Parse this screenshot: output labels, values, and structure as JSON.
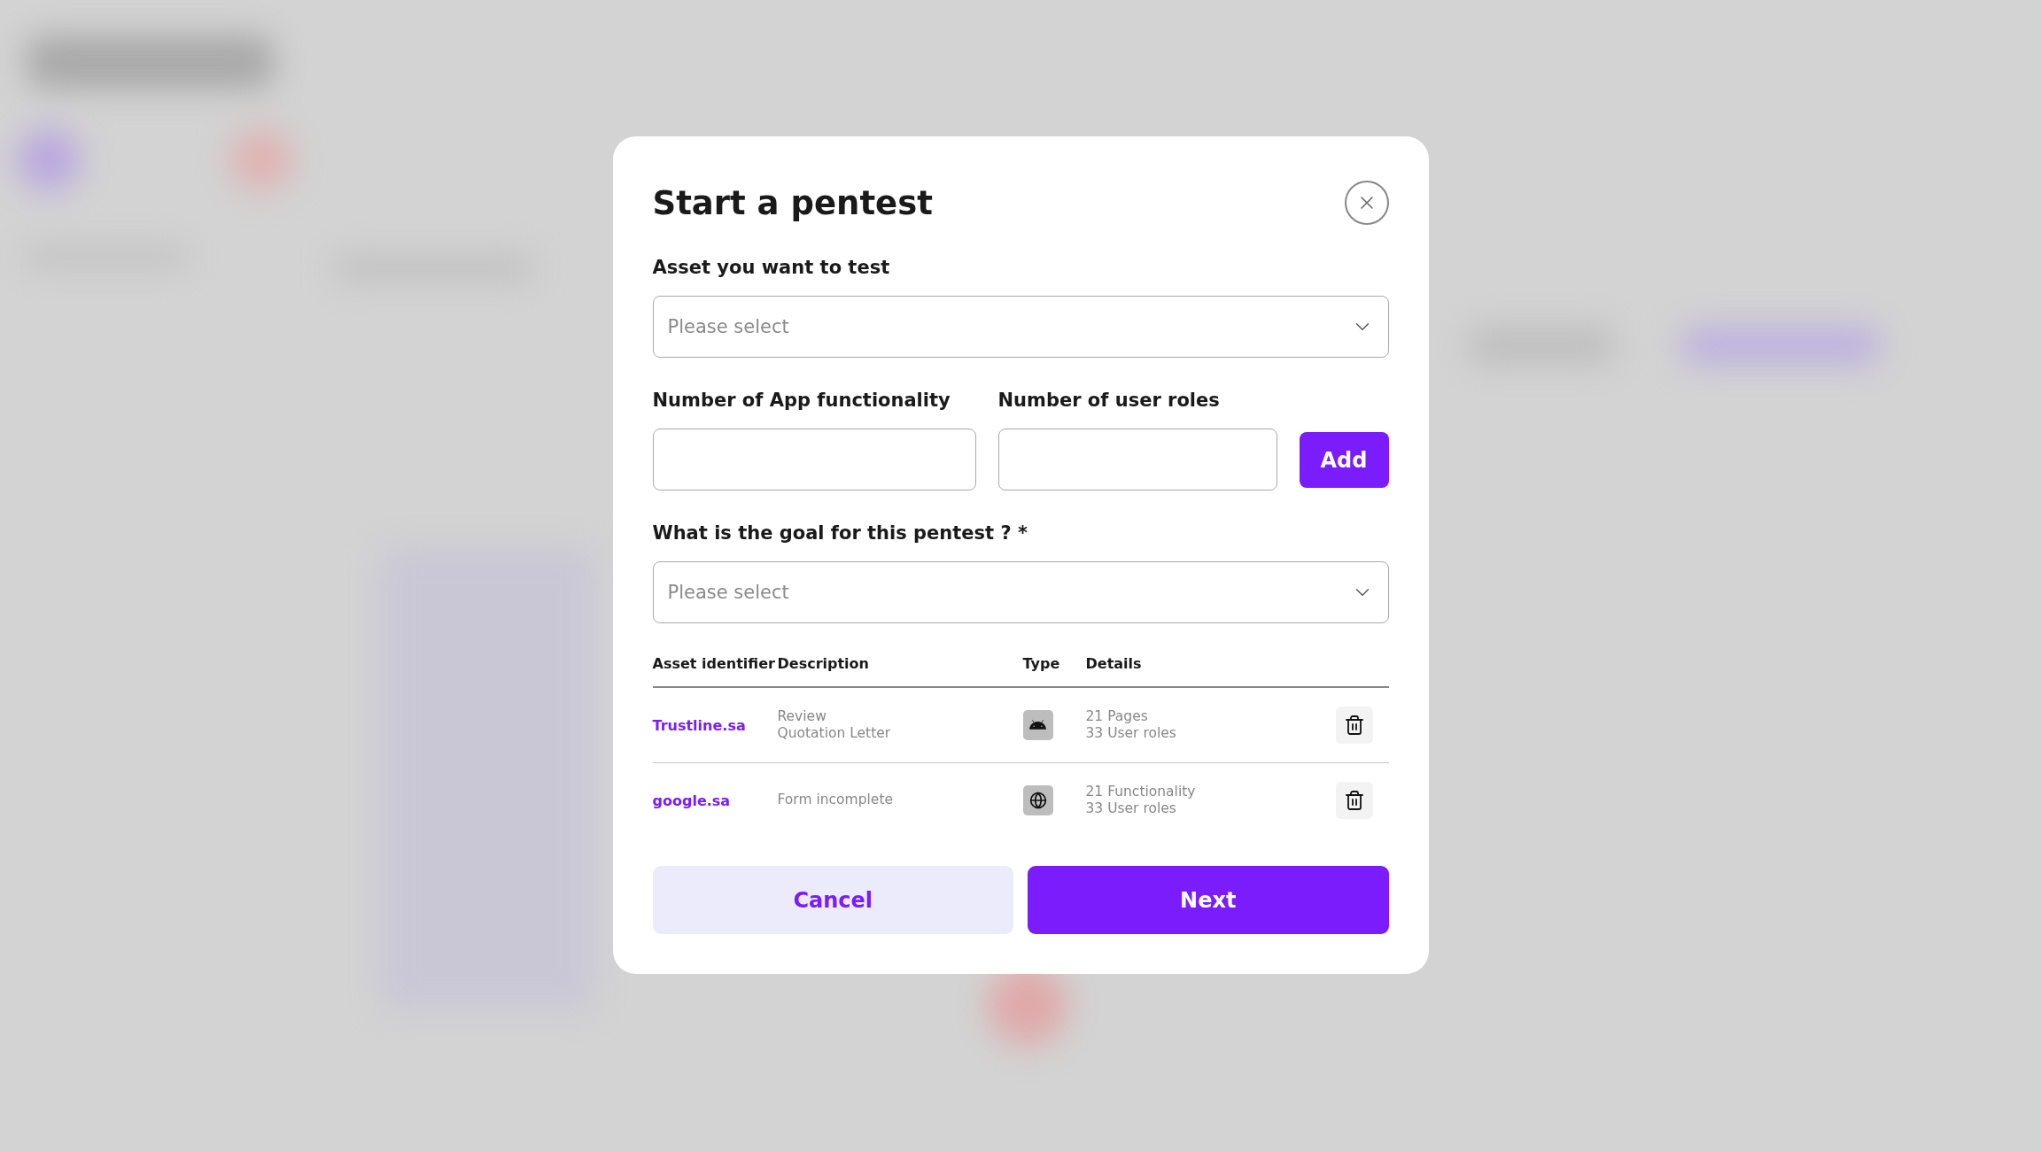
{
  "dialog": {
    "title": "Start a pentest",
    "asset_field": {
      "label": "Asset you want to test",
      "placeholder": "Please select"
    },
    "functionality_field": {
      "label": "Number of App functionality"
    },
    "roles_field": {
      "label": "Number of user roles"
    },
    "add_button": "Add",
    "goal_field": {
      "label": "What is the goal for this pentest ? *",
      "placeholder": "Please select"
    },
    "table": {
      "columns": [
        "Asset identifier",
        "Description",
        "Type",
        "Details"
      ],
      "rows": [
        {
          "asset": "Trustline.sa",
          "description": [
            "Review",
            "Quotation Letter"
          ],
          "kind": "android",
          "details": [
            "21 Pages",
            "33 User roles"
          ]
        },
        {
          "asset": "google.sa",
          "description": [
            "Form incomplete"
          ],
          "kind": "web",
          "details": [
            "21 Functionality",
            "33 User roles"
          ]
        }
      ]
    },
    "buttons": {
      "cancel": "Cancel",
      "next": "Next"
    }
  }
}
